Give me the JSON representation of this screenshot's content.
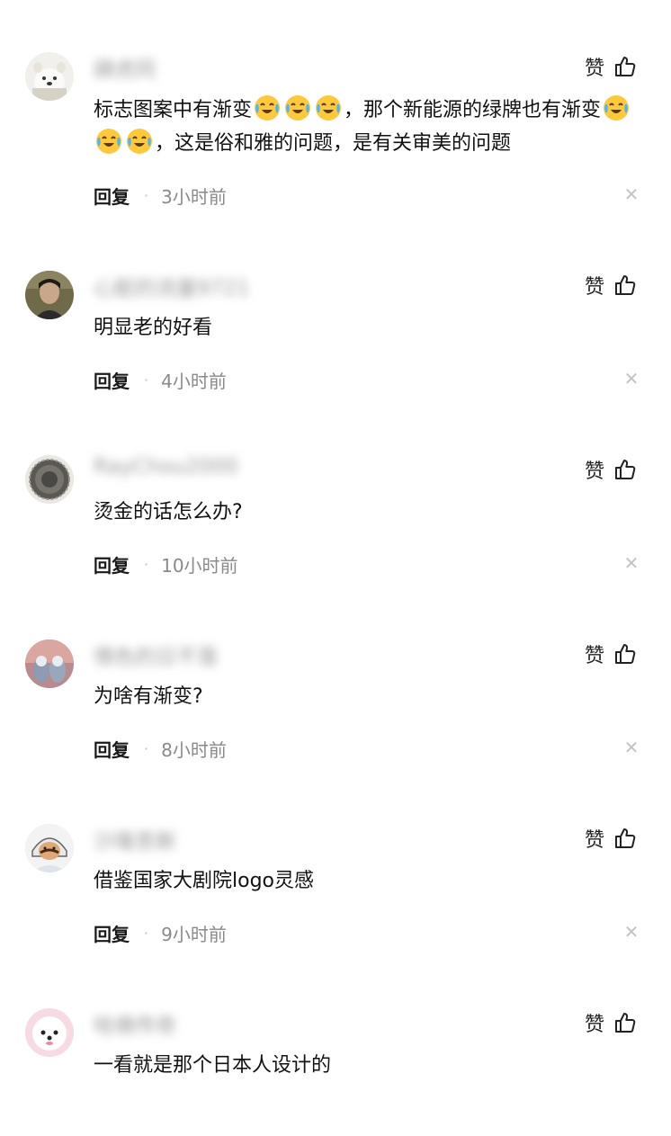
{
  "like_label": "赞",
  "reply_label": "回复",
  "comments": [
    {
      "username": "肆虎同",
      "text_parts": [
        "标志图案中有渐变",
        "，那个新能源的绿牌也有渐变",
        "，这是俗和雅的问题，是有关审美的问题"
      ],
      "emoji": "crying-laughing-emoji",
      "time": "3小时前"
    },
    {
      "username": "心脏的流量9721",
      "text": "明显老的好看",
      "time": "4小时前"
    },
    {
      "username": "RayChou2000",
      "text": "烫金的话怎么办?",
      "time": "10小时前"
    },
    {
      "username": "情色的日不落",
      "text": "为啥有渐变?",
      "time": "8小时前"
    },
    {
      "username": "沙隆思斯",
      "text": "借鉴国家大剧院logo灵感",
      "time": "9小时前"
    },
    {
      "username": "哈佛传奇",
      "text": "一看就是那个日本人设计的",
      "time": ""
    }
  ],
  "colors": {
    "username": "#9a9a9a",
    "time": "#8a8a8a",
    "close": "#c4c4c4"
  }
}
